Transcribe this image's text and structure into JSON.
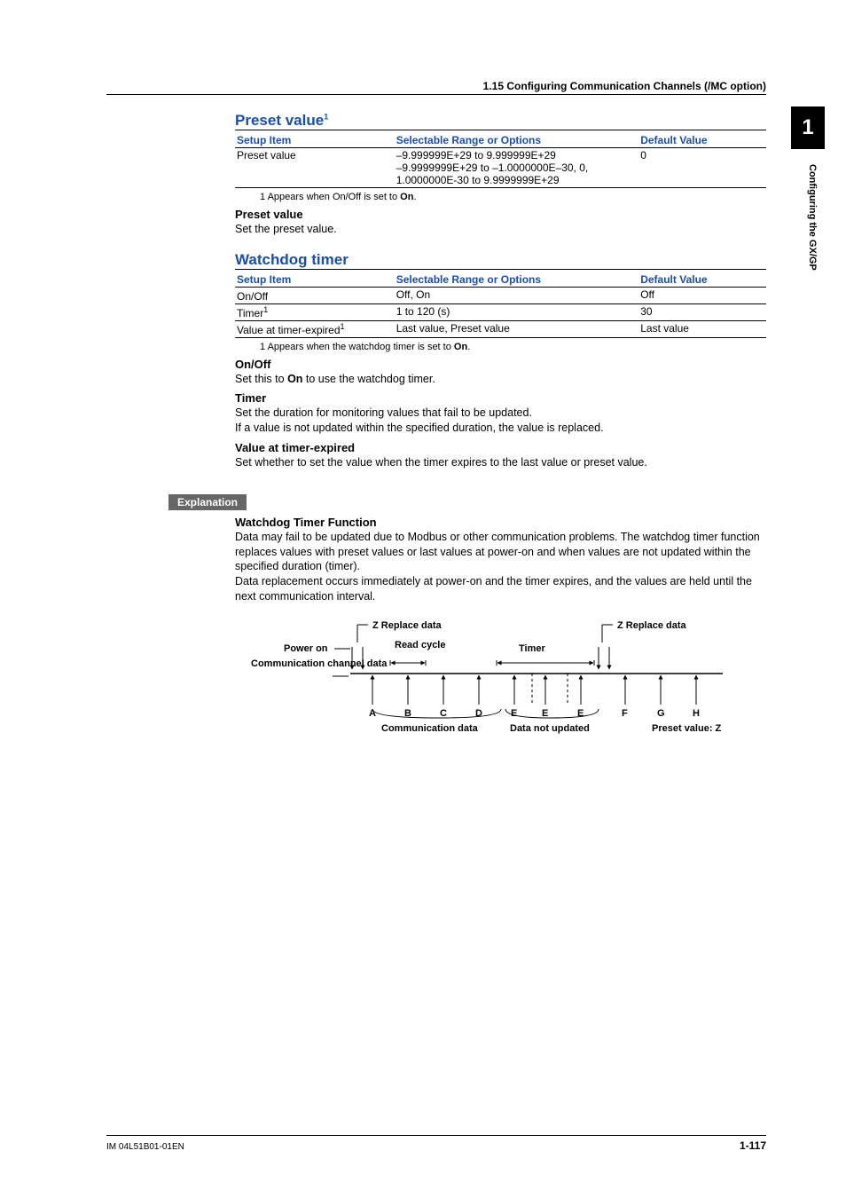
{
  "running_head": "1.15  Configuring Communication Channels (/MC option)",
  "side_tab": "1",
  "side_label": "Configuring the GX/GP",
  "preset": {
    "title": "Preset value",
    "title_sup": "1",
    "headers": {
      "c1": "Setup Item",
      "c2": "Selectable Range or Options",
      "c3": "Default Value"
    },
    "rows": [
      {
        "c1": "Preset value",
        "c2": "–9.999999E+29 to 9.999999E+29\n–9.9999999E+29 to –1.0000000E–30, 0,\n1.0000000E-30 to 9.9999999E+29",
        "c3": "0"
      }
    ],
    "footnote": "1   Appears when On/Off is set to ",
    "footnote_bold": "On",
    "footnote_tail": ".",
    "sub_h": "Preset value",
    "sub_p": "Set the preset value."
  },
  "watchdog": {
    "title": "Watchdog timer",
    "headers": {
      "c1": "Setup Item",
      "c2": "Selectable Range or Options",
      "c3": "Default Value"
    },
    "rows": [
      {
        "c1": "On/Off",
        "c1_sup": "",
        "c2": "Off, On",
        "c3": "Off"
      },
      {
        "c1": "Timer",
        "c1_sup": "1",
        "c2": "1 to 120 (s)",
        "c3": "30"
      },
      {
        "c1": "Value at timer-expired",
        "c1_sup": "1",
        "c2": "Last value, Preset value",
        "c3": "Last value"
      }
    ],
    "footnote": "1   Appears when the watchdog timer is set to ",
    "footnote_bold": "On",
    "footnote_tail": ".",
    "s1_h": "On/Off",
    "s1_p_a": "Set this to ",
    "s1_p_b": "On",
    "s1_p_c": " to use the watchdog timer.",
    "s2_h": "Timer",
    "s2_p": "Set the duration for monitoring values that fail to be updated.\nIf a value is not updated within the specified duration, the value is replaced.",
    "s3_h": "Value at timer-expired",
    "s3_p": "Set whether to set the value when the timer expires to the last value or preset value."
  },
  "explanation": {
    "tag": "Explanation",
    "h": "Watchdog Timer Function",
    "p": "Data may fail to be updated due to Modbus or other communication problems. The watchdog timer function replaces values with preset values or last values at power-on and when values are not updated within the specified duration (timer).\nData replacement occurs immediately at power-on and the timer expires, and the values are held until the next communication interval."
  },
  "diagram": {
    "z1": "Z  Replace data",
    "z2": "Z  Replace data",
    "power_on": "Power on",
    "read_cycle": "Read cycle",
    "timer": "Timer",
    "chan": "Communication\nchannel data",
    "letters": [
      "A",
      "B",
      "C",
      "D",
      "E",
      "E",
      "E",
      "F",
      "G",
      "H"
    ],
    "comm_data": "Communication data",
    "not_updated": "Data not updated",
    "preset_z": "Preset value: Z"
  },
  "footer": {
    "left": "IM 04L51B01-01EN",
    "right_prefix": "1-",
    "right_page": "117"
  }
}
